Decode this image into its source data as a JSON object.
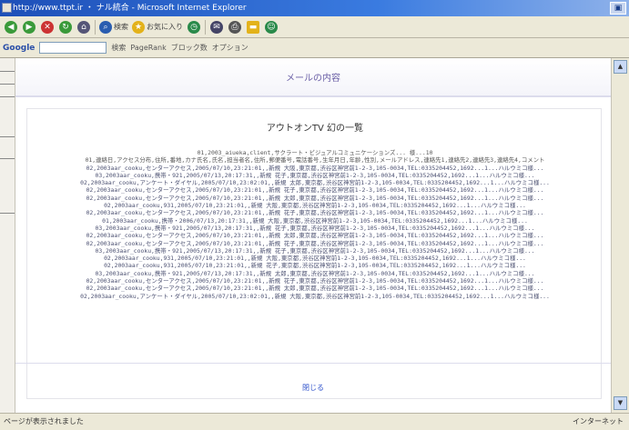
{
  "window": {
    "title": "http://www.ttpt.ir ・ ナル統合 - Microsoft Internet Explorer"
  },
  "toolbar": {
    "buttons": [
      {
        "icon": "back-arrow-icon",
        "label": "",
        "color": "#3a9a3a"
      },
      {
        "icon": "forward-arrow-icon",
        "label": "",
        "color": "#3a9a3a"
      },
      {
        "icon": "stop-icon",
        "label": "",
        "color": "#c33"
      },
      {
        "icon": "refresh-icon",
        "label": "",
        "color": "#3a9a3a"
      },
      {
        "icon": "home-icon",
        "label": "",
        "color": "#557"
      },
      {
        "icon": "search-icon",
        "label": "検索",
        "color": "#2a5db0"
      },
      {
        "icon": "favorites-icon",
        "label": "お気に入り",
        "color": "#e3b21a"
      },
      {
        "icon": "history-icon",
        "label": "",
        "color": "#2a8a4a"
      },
      {
        "icon": "mail-icon",
        "label": "",
        "color": "#446"
      },
      {
        "icon": "print-icon",
        "label": "",
        "color": "#555"
      },
      {
        "icon": "folder-icon",
        "label": "",
        "color": "#e3b21a"
      },
      {
        "icon": "messenger-icon",
        "label": "",
        "color": "#2a8a4a"
      }
    ]
  },
  "google_bar": {
    "logo": "Google",
    "search_value": "",
    "items": [
      "検索",
      "PageRank",
      "ブロック数",
      "オプション"
    ]
  },
  "page": {
    "header_title": "メールの内容",
    "card_title": "アウトオンTV 幻の一覧",
    "rows": [
      "01,2003_aiueka,client,サクラート・ビジュアルコミュニケーションズ... 様...10",
      "01,連絡日,アクセス分布,住所,番地,カナ氏名,氏名,担当者名,住所,郵便番号,電話番号,生年月日,年齢,性別,メールアドレス,連絡先1,連絡先2,連絡先3,連絡先4,コメント",
      "02,2003aar_cooku,センターアクセス,2005/07/10,23:21:01,,新規 大阪,東京都,渋谷区神宮前1-2-3,105-0034,TEL:0335204452,1692...1...ハルウミコ様...",
      "03,2003aar_cooku,携帯・921,2005/07/13,20:17:31,,新規 花子,東京都,渋谷区神宮前1-2-3,105-0034,TEL:0335204452,1692...1...ハルウミコ様...",
      "02,2003aar_cooku,アンケート・ダイヤル,2005/07/10,23:02:01,,新規 太郎,東京都,渋谷区神宮前1-2-3,105-0034,TEL:0335204452,1692...1...ハルウミコ様...",
      "02,2003aar_cooku,センターアクセス,2005/07/10,23:21:01,,新規 花子,東京都,渋谷区神宮前1-2-3,105-0034,TEL:0335204452,1692...1...ハルウミコ様...",
      "02,2003aar_cooku,センターアクセス,2005/07/10,23:21:01,,新規 太郎,東京都,渋谷区神宮前1-2-3,105-0034,TEL:0335204452,1692...1...ハルウミコ様...",
      "02,2003aar_cooku,931,2005/07/10,23:21:01,,新規 大阪,東京都,渋谷区神宮前1-2-3,105-0034,TEL:0335204452,1692...1...ハルウミコ様...",
      "02,2003aar_cooku,センターアクセス,2005/07/10,23:21:01,,新規 花子,東京都,渋谷区神宮前1-2-3,105-0034,TEL:0335204452,1692...1...ハルウミコ様...",
      "01,2003aar_cooku,携帯・2006/07/13,20:17:31,,新規 大阪,東京都,渋谷区神宮前1-2-3,105-0034,TEL:0335204452,1692...1...ハルウミコ様...",
      "03,2003aar_cooku,携帯・921,2005/07/13,20:17:31,,新規 花子,東京都,渋谷区神宮前1-2-3,105-0034,TEL:0335204452,1692...1...ハルウミコ様...",
      "02,2003aar_cooku,センターアクセス,2005/07/10,23:21:01,,新規 太郎,東京都,渋谷区神宮前1-2-3,105-0034,TEL:0335204452,1692...1...ハルウミコ様...",
      "02,2003aar_cooku,センターアクセス,2005/07/10,23:21:01,,新規 花子,東京都,渋谷区神宮前1-2-3,105-0034,TEL:0335204452,1692...1...ハルウミコ様...",
      "03,2003aar_cooku,携帯・921,2005/07/13,20:17:31,,新規 花子,東京都,渋谷区神宮前1-2-3,105-0034,TEL:0335204452,1692...1...ハルウミコ様...",
      "02,2003aar_cooku,931,2005/07/10,23:21:01,,新規 大阪,東京都,渋谷区神宮前1-2-3,105-0034,TEL:0335204452,1692...1...ハルウミコ様...",
      "02,2003aar_cooku,931,2005/07/10,23:21:01,,新規 花子,東京都,渋谷区神宮前1-2-3,105-0034,TEL:0335204452,1692...1...ハルウミコ様...",
      "03,2003aar_cooku,携帯・921,2005/07/13,20:17:31,,新規 太郎,東京都,渋谷区神宮前1-2-3,105-0034,TEL:0335204452,1692...1...ハルウミコ様...",
      "02,2003aar_cooku,センターアクセス,2005/07/10,23:21:01,,新規 花子,東京都,渋谷区神宮前1-2-3,105-0034,TEL:0335204452,1692...1...ハルウミコ様...",
      "02,2003aar_cooku,センターアクセス,2005/07/10,23:21:01,,新規 太郎,東京都,渋谷区神宮前1-2-3,105-0034,TEL:0335204452,1692...1...ハルウミコ様...",
      "02,2003aar_cooku,アンケート・ダイヤル,2005/07/10,23:02:01,,新規 大阪,東京都,渋谷区神宮前1-2-3,105-0034,TEL:0335204452,1692...1...ハルウミコ様..."
    ],
    "footer_link": "閉じる"
  },
  "statusbar": {
    "text": "ページが表示されました",
    "zone": "インターネット"
  }
}
